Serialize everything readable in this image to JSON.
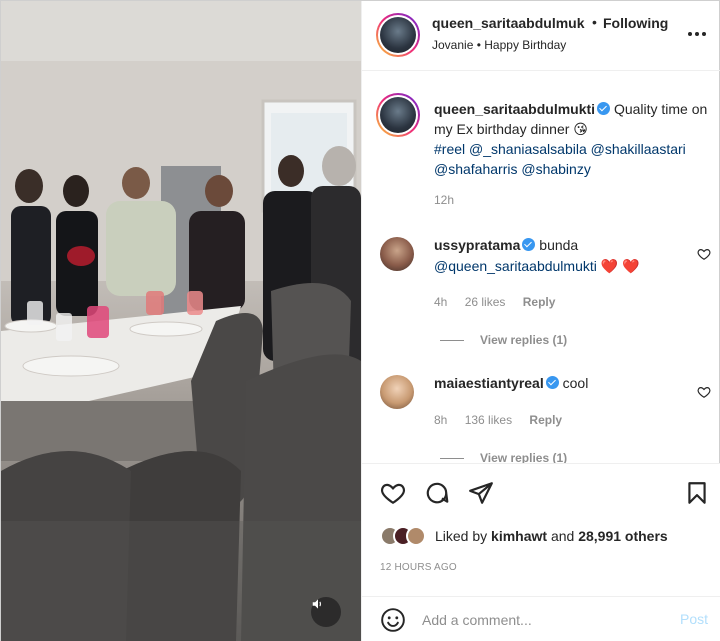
{
  "post": {
    "username": "queen_saritaabdulmukti",
    "username_truncated": "queen_saritaabdulmuk",
    "follow_separator": "•",
    "follow_status": "Following",
    "location": "Jovanie",
    "location_separator": "•",
    "audio": "Happy Birthday",
    "caption_text": "Quality time on my Ex birthday dinner",
    "caption_emoji": "😘",
    "caption_tags": "#reel @_shaniasalsabila @shakillaastari @shafaharris @shabinzy",
    "caption_time": "12h"
  },
  "comments": [
    {
      "username": "ussypratama",
      "text": "bunda",
      "mention": "@queen_saritaabdulmukti",
      "hearts": "❤️ ❤️",
      "time": "4h",
      "likes": "26 likes",
      "reply": "Reply",
      "view_replies": "View replies (1)"
    },
    {
      "username": "maiaestiantyreal",
      "text": "cool",
      "time": "8h",
      "likes": "136 likes",
      "reply": "Reply",
      "view_replies": "View replies (1)"
    }
  ],
  "engagement": {
    "liked_by_prefix": "Liked by",
    "liked_by_user": "kimhawt",
    "liked_by_suffix": "and",
    "others": "28,991 others",
    "post_age": "12 HOURS AGO"
  },
  "composer": {
    "placeholder": "Add a comment...",
    "post_label": "Post"
  },
  "icons": {
    "more": "more-options-icon",
    "like": "heart-icon",
    "comment": "comment-icon",
    "share": "share-icon",
    "save": "bookmark-icon",
    "emoji": "emoji-icon",
    "mute": "speaker-icon"
  },
  "colors": {
    "link": "#00376b",
    "verified": "#3897f0",
    "muted": "#8e8e8e",
    "post_disabled": "#b2dffc"
  }
}
